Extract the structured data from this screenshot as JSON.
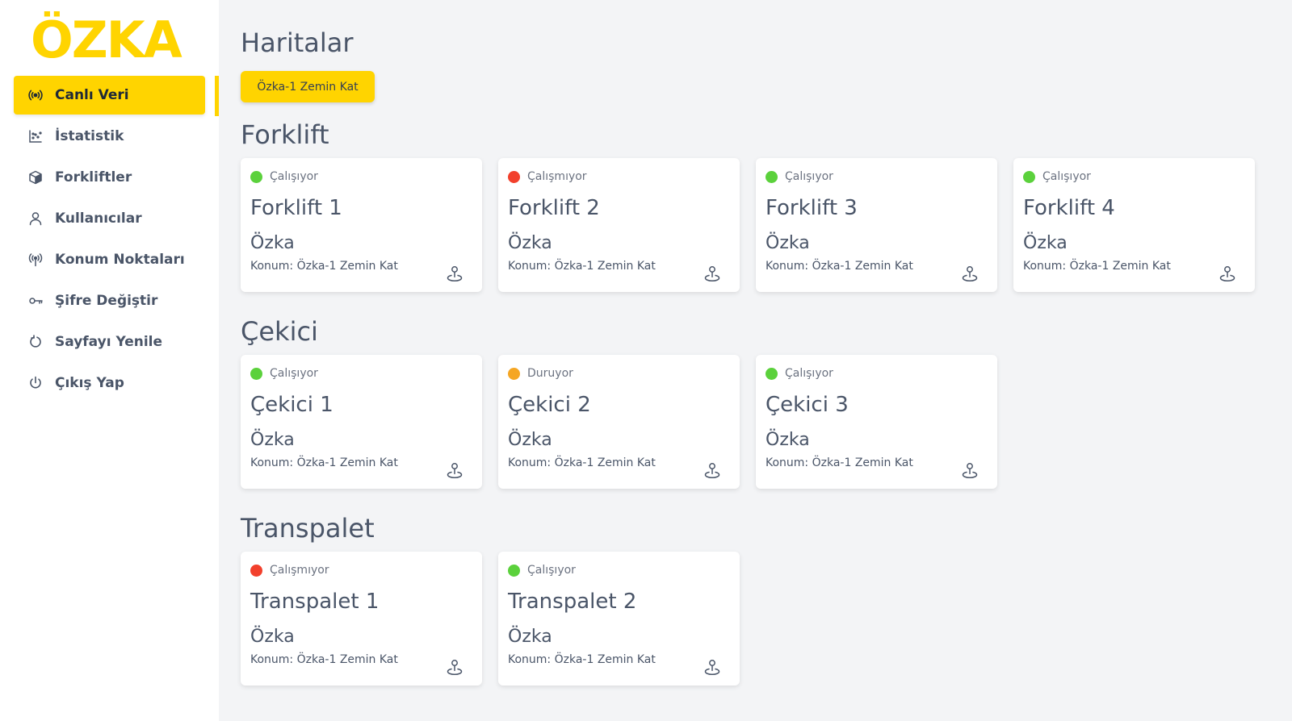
{
  "brand": {
    "logo_text": "ÖZKA",
    "logo_color": "#ffd400"
  },
  "colors": {
    "accent": "#ffd400",
    "status_working": "#5bd13c",
    "status_not_working": "#f2402c",
    "status_idle": "#f5a623"
  },
  "sidebar": {
    "items": [
      {
        "label": "Canlı Veri",
        "icon": "live-broadcast-icon",
        "active": true
      },
      {
        "label": "İstatistik",
        "icon": "chart-icon",
        "active": false
      },
      {
        "label": "Forkliftler",
        "icon": "box-icon",
        "active": false
      },
      {
        "label": "Kullanıcılar",
        "icon": "user-icon",
        "active": false
      },
      {
        "label": "Konum Noktaları",
        "icon": "antenna-icon",
        "active": false
      },
      {
        "label": "Şifre Değiştir",
        "icon": "key-icon",
        "active": false
      },
      {
        "label": "Sayfayı Yenile",
        "icon": "refresh-icon",
        "active": false
      },
      {
        "label": "Çıkış Yap",
        "icon": "power-icon",
        "active": false
      }
    ]
  },
  "main": {
    "title": "Haritalar",
    "map_button_label": "Özka-1 Zemin Kat",
    "sections": [
      {
        "title": "Forklift",
        "cards": [
          {
            "status": "Çalışıyor",
            "status_color": "#5bd13c",
            "name": "Forklift 1",
            "company": "Özka",
            "location": "Konum: Özka-1 Zemin Kat"
          },
          {
            "status": "Çalışmıyor",
            "status_color": "#f2402c",
            "name": "Forklift 2",
            "company": "Özka",
            "location": "Konum: Özka-1 Zemin Kat"
          },
          {
            "status": "Çalışıyor",
            "status_color": "#5bd13c",
            "name": "Forklift 3",
            "company": "Özka",
            "location": "Konum: Özka-1 Zemin Kat"
          },
          {
            "status": "Çalışıyor",
            "status_color": "#5bd13c",
            "name": "Forklift 4",
            "company": "Özka",
            "location": "Konum: Özka-1 Zemin Kat"
          }
        ]
      },
      {
        "title": "Çekici",
        "cards": [
          {
            "status": "Çalışıyor",
            "status_color": "#5bd13c",
            "name": "Çekici 1",
            "company": "Özka",
            "location": "Konum: Özka-1 Zemin Kat"
          },
          {
            "status": "Duruyor",
            "status_color": "#f5a623",
            "name": "Çekici 2",
            "company": "Özka",
            "location": "Konum: Özka-1 Zemin Kat"
          },
          {
            "status": "Çalışıyor",
            "status_color": "#5bd13c",
            "name": "Çekici 3",
            "company": "Özka",
            "location": "Konum: Özka-1 Zemin Kat"
          }
        ]
      },
      {
        "title": "Transpalet",
        "cards": [
          {
            "status": "Çalışmıyor",
            "status_color": "#f2402c",
            "name": "Transpalet 1",
            "company": "Özka",
            "location": "Konum: Özka-1 Zemin Kat"
          },
          {
            "status": "Çalışıyor",
            "status_color": "#5bd13c",
            "name": "Transpalet 2",
            "company": "Özka",
            "location": "Konum: Özka-1 Zemin Kat"
          }
        ]
      }
    ]
  }
}
